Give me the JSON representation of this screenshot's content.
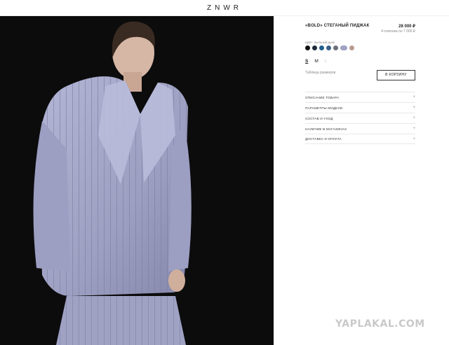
{
  "header": {
    "logo": "ZNWR"
  },
  "product": {
    "title": "«BOLD» СТЕГАНЫЙ ПИДЖАК",
    "price": "28 000 ₽",
    "installment": "4 платежа по 7 000 ₽",
    "color_label": "Цвет: пыльный дым",
    "swatches": [
      "#111111",
      "#1e2a3a",
      "#1f5e8c",
      "#3b5f86",
      "#6a6f7a",
      "#9ea3c4",
      "#b79b8e"
    ],
    "sizes": [
      {
        "label": "S",
        "state": "active"
      },
      {
        "label": "M",
        "state": "available"
      },
      {
        "label": "L",
        "state": "disabled"
      }
    ],
    "size_table": "Таблица размеров",
    "cart_button": "В КОРЗИНУ"
  },
  "accordion": [
    {
      "label": "ОПИСАНИЕ ТОВАРА",
      "icon": "+"
    },
    {
      "label": "ПАРАМЕТРЫ МОДЕЛИ",
      "icon": "+"
    },
    {
      "label": "СОСТАВ И УХОД",
      "icon": "+"
    },
    {
      "label": "НАЛИЧИЕ В МАГАЗИНАХ",
      "icon": "+"
    },
    {
      "label": "ДОСТАВКА И ОПЛАТА",
      "icon": "+"
    }
  ],
  "watermark": "YAPLAKAL.COM",
  "colors": {
    "jacket": "#a5a7c9",
    "background": "#0c0c0d"
  }
}
